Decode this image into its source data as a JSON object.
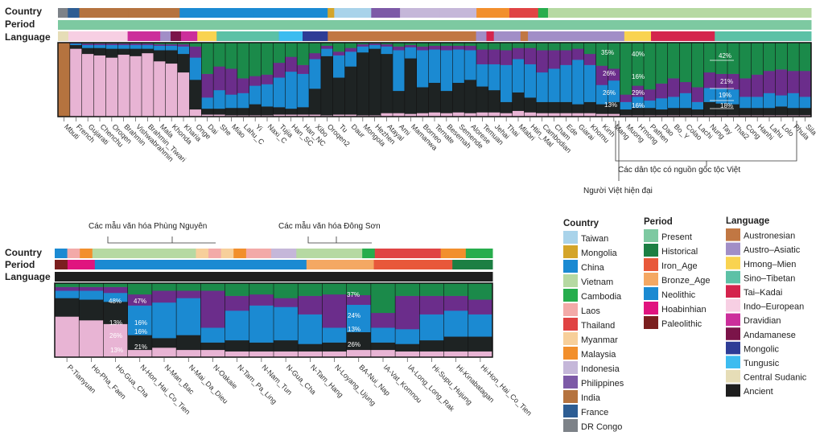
{
  "row_labels": {
    "country": "Country",
    "period": "Period",
    "language": "Language"
  },
  "colors": {
    "country": {
      "Taiwan": "#a9d3ea",
      "Mongolia": "#d4a52a",
      "China": "#1b8ad2",
      "Vietnam": "#b6d9a2",
      "Cambodia": "#27ad4d",
      "Laos": "#f3aaa8",
      "Thailand": "#e04343",
      "Myanmar": "#f7cf9a",
      "Malaysia": "#f28f2c",
      "Indonesia": "#c5b7d9",
      "Philippines": "#7d5aa7",
      "India": "#b5733f",
      "France": "#2d5d93",
      "DR Congo": "#7d8288"
    },
    "period": {
      "Present": "#7dc9a1",
      "Historical": "#1c7f43",
      "Iron_Age": "#e8583a",
      "Bronze_Age": "#f4a863",
      "Neolithic": "#1b8ad2",
      "Hoabinhian": "#e0147f",
      "Paleolithic": "#7b1f1f"
    },
    "language": {
      "Austronesian": "#c17743",
      "Austro-Asiatic": "#a18ec7",
      "Hmong-Mien": "#f9d350",
      "Sino-Tibetan": "#5cc1a6",
      "Tai-Kadai": "#d4244d",
      "Indo-European": "#f7cfe3",
      "Dravidian": "#cc2e9b",
      "Andamanese": "#7b1449",
      "Mongolic": "#2e3c96",
      "Tungusic": "#3dbcf0",
      "Central Sudanic": "#e6ddb7",
      "Ancient": "#1e1e1e"
    }
  },
  "legend": {
    "country_title": "Country",
    "period_title": "Period",
    "language_title": "Language",
    "country": [
      "Taiwan",
      "Mongolia",
      "China",
      "Vietnam",
      "Cambodia",
      "Laos",
      "Thailand",
      "Myanmar",
      "Malaysia",
      "Indonesia",
      "Philippines",
      "India",
      "France",
      "DR Congo"
    ],
    "period": [
      "Present",
      "Historical",
      "Iron_Age",
      "Bronze_Age",
      "Neolithic",
      "Hoabinhian",
      "Paleolithic"
    ],
    "language": [
      "Austronesian",
      "Austro–Asiatic",
      "Hmong–Mien",
      "Sino–Tibetan",
      "Tai–Kadai",
      "Indo–European",
      "Dravidian",
      "Andamanese",
      "Mongolic",
      "Tungusic",
      "Central Sudanic",
      "Ancient"
    ]
  },
  "chart_data": [
    {
      "type": "bar",
      "stacked": true,
      "series": [
        {
          "name": "",
          "color": "#e8b4d4"
        },
        {
          "name": "",
          "color": "#1e2323"
        },
        {
          "name": "",
          "color": "#1b8ad2"
        },
        {
          "name": "",
          "color": "#6b2d8b"
        },
        {
          "name": "",
          "color": "#1b8a4a"
        },
        {
          "name": "",
          "color": "#b5733f"
        }
      ],
      "categories": [
        "Mbuti",
        "French",
        "Gujarati",
        "Chenchu",
        "Oroqen",
        "Brahmin",
        "Vishwabrahmin",
        "Brahmin_Tiwari",
        "Mala",
        "Khonda",
        "Kharia",
        "Onge",
        "Dai",
        "She",
        "Miao",
        "Lahu_C",
        "Yi",
        "Naxi_C",
        "Tujia",
        "Han_SC",
        "Han_NC",
        "Xibo",
        "Oroqen2",
        "Tu",
        "Daur",
        "Mongola",
        "Hezhen",
        "Atayal",
        "Ami",
        "Mamanwa",
        "Borneo",
        "Ternate",
        "Besemah",
        "Semende",
        "Alorese",
        "Temuan",
        "Jehai",
        "Thai",
        "Mlabri",
        "Htin_Mal",
        "Cambodian",
        "Cham",
        "Ede",
        "Giarai",
        "Khomu",
        "Kinh",
        "Mang",
        "Muong",
        "H'mong",
        "Pathen",
        "Dao",
        "Bo_Y",
        "Colao",
        "Lachi",
        "Nung",
        "Tay",
        "Thai2",
        "Cong",
        "Hanhi",
        "Lahu",
        "Lolo",
        "Phula",
        "Sila"
      ],
      "fractions": [
        [
          0,
          0,
          0,
          0,
          0,
          1
        ],
        [
          0.92,
          0.05,
          0.02,
          0.01,
          0,
          0
        ],
        [
          0.85,
          0.08,
          0.04,
          0.02,
          0.01,
          0
        ],
        [
          0.83,
          0.1,
          0.04,
          0.02,
          0.01,
          0
        ],
        [
          0.8,
          0.12,
          0.05,
          0.02,
          0.01,
          0
        ],
        [
          0.84,
          0.08,
          0.05,
          0.02,
          0.01,
          0
        ],
        [
          0.82,
          0.1,
          0.05,
          0.02,
          0.01,
          0
        ],
        [
          0.86,
          0.06,
          0.05,
          0.02,
          0.01,
          0
        ],
        [
          0.75,
          0.15,
          0.06,
          0.02,
          0.02,
          0
        ],
        [
          0.72,
          0.18,
          0.06,
          0.02,
          0.02,
          0
        ],
        [
          0.6,
          0.25,
          0.1,
          0.03,
          0.02,
          0
        ],
        [
          0.1,
          0.4,
          0.3,
          0.15,
          0.05,
          0
        ],
        [
          0.03,
          0.08,
          0.15,
          0.32,
          0.42,
          0
        ],
        [
          0.03,
          0.08,
          0.25,
          0.32,
          0.32,
          0
        ],
        [
          0.02,
          0.1,
          0.18,
          0.35,
          0.35,
          0
        ],
        [
          0.02,
          0.1,
          0.2,
          0.2,
          0.48,
          0
        ],
        [
          0.02,
          0.15,
          0.25,
          0.13,
          0.45,
          0
        ],
        [
          0.02,
          0.12,
          0.3,
          0.13,
          0.43,
          0
        ],
        [
          0.03,
          0.1,
          0.4,
          0.2,
          0.27,
          0
        ],
        [
          0.03,
          0.08,
          0.5,
          0.2,
          0.19,
          0
        ],
        [
          0.03,
          0.1,
          0.45,
          0.12,
          0.3,
          0
        ],
        [
          0.03,
          0.35,
          0.4,
          0.08,
          0.14,
          0
        ],
        [
          0.02,
          0.8,
          0.1,
          0.04,
          0.04,
          0
        ],
        [
          0.03,
          0.5,
          0.3,
          0.05,
          0.12,
          0
        ],
        [
          0.03,
          0.65,
          0.2,
          0.05,
          0.07,
          0
        ],
        [
          0.02,
          0.85,
          0.08,
          0.03,
          0.02,
          0
        ],
        [
          0.02,
          0.9,
          0.05,
          0.02,
          0.01,
          0
        ],
        [
          0.05,
          0.8,
          0.1,
          0.03,
          0.02,
          0
        ],
        [
          0.05,
          0.3,
          0.55,
          0.05,
          0.05,
          0
        ],
        [
          0.04,
          0.75,
          0.15,
          0.03,
          0.03,
          0
        ],
        [
          0.05,
          0.35,
          0.5,
          0.05,
          0.05,
          0
        ],
        [
          0.06,
          0.4,
          0.45,
          0.05,
          0.04,
          0
        ],
        [
          0.05,
          0.3,
          0.55,
          0.06,
          0.04,
          0
        ],
        [
          0.06,
          0.4,
          0.45,
          0.05,
          0.04,
          0
        ],
        [
          0.05,
          0.45,
          0.4,
          0.06,
          0.04,
          0
        ],
        [
          0.06,
          0.35,
          0.3,
          0.2,
          0.09,
          0
        ],
        [
          0.06,
          0.3,
          0.35,
          0.2,
          0.09,
          0
        ],
        [
          0.05,
          0.15,
          0.5,
          0.2,
          0.1,
          0
        ],
        [
          0.08,
          0.25,
          0.45,
          0.15,
          0.07,
          0
        ],
        [
          0.06,
          0.2,
          0.45,
          0.22,
          0.07,
          0
        ],
        [
          0.05,
          0.15,
          0.4,
          0.3,
          0.1,
          0
        ],
        [
          0.05,
          0.15,
          0.45,
          0.25,
          0.1,
          0
        ],
        [
          0.05,
          0.15,
          0.5,
          0.2,
          0.1,
          0
        ],
        [
          0.05,
          0.12,
          0.6,
          0.15,
          0.08,
          0
        ],
        [
          0.05,
          0.15,
          0.5,
          0.15,
          0.15,
          0
        ],
        [
          0.04,
          0.13,
          0.26,
          0.26,
          0.31,
          0
        ],
        [
          0.04,
          0.16,
          0.29,
          0.16,
          0.35,
          0
        ],
        [
          0.02,
          0.08,
          0.1,
          0.1,
          0.7,
          0
        ],
        [
          0.02,
          0.1,
          0.15,
          0.15,
          0.58,
          0
        ],
        [
          0.02,
          0.1,
          0.1,
          0.15,
          0.63,
          0
        ],
        [
          0.02,
          0.08,
          0.15,
          0.2,
          0.55,
          0
        ],
        [
          0.02,
          0.1,
          0.15,
          0.25,
          0.48,
          0
        ],
        [
          0.02,
          0.1,
          0.2,
          0.15,
          0.53,
          0
        ],
        [
          0.02,
          0.08,
          0.1,
          0.2,
          0.6,
          0
        ],
        [
          0.02,
          0.18,
          0.19,
          0.21,
          0.4,
          0
        ],
        [
          0.02,
          0.16,
          0.2,
          0.2,
          0.42,
          0
        ],
        [
          0.02,
          0.15,
          0.2,
          0.21,
          0.42,
          0
        ],
        [
          0.02,
          0.1,
          0.15,
          0.25,
          0.48,
          0
        ],
        [
          0.02,
          0.1,
          0.15,
          0.3,
          0.43,
          0
        ],
        [
          0.02,
          0.1,
          0.2,
          0.3,
          0.38,
          0
        ],
        [
          0.02,
          0.12,
          0.15,
          0.35,
          0.36,
          0
        ],
        [
          0.02,
          0.1,
          0.2,
          0.3,
          0.38,
          0
        ],
        [
          0.02,
          0.1,
          0.15,
          0.35,
          0.38,
          0
        ]
      ],
      "annotations": [
        "35%",
        "26%",
        "26%",
        "13%",
        "40%",
        "16%",
        "29%",
        "16%",
        "42%",
        "21%",
        "19%",
        "18%"
      ]
    },
    {
      "type": "bar",
      "stacked": true,
      "series": [
        {
          "name": "",
          "color": "#e8b4d4"
        },
        {
          "name": "",
          "color": "#1e2323"
        },
        {
          "name": "",
          "color": "#1b8ad2"
        },
        {
          "name": "",
          "color": "#6b2d8b"
        },
        {
          "name": "",
          "color": "#1b8a4a"
        },
        {
          "name": "",
          "color": "#b5733f"
        }
      ],
      "categories": [
        "P-Tianyuan",
        "Ho-Pha_Faen",
        "Ho-Gua_Cha",
        "N-Hon_Hai_Co_Tien",
        "N-Man_Bac",
        "N-Mai_Da_Dieu",
        "N-Oakaie",
        "N-Tam_Pa_Ling",
        "N-Nam_Tun",
        "N-Gua_Cha",
        "N-Tam_Hang",
        "N-Loyang_Ujung",
        "BA-Nui_Nap",
        "IA-Vat_Komnou",
        "IA-Long_Long_Rak",
        "Hi-Supu_Hujung",
        "Hi-Kinabatagan",
        "Hi-Hon_Hai_Co_Tien"
      ],
      "fractions": [
        [
          0.55,
          0.25,
          0.1,
          0.05,
          0.05,
          0
        ],
        [
          0.5,
          0.28,
          0.12,
          0.05,
          0.05,
          0
        ],
        [
          0.45,
          0.3,
          0.12,
          0.08,
          0.05,
          0
        ],
        [
          0.1,
          0.2,
          0.4,
          0.15,
          0.15,
          0
        ],
        [
          0.13,
          0.13,
          0.48,
          0.16,
          0.1,
          0
        ],
        [
          0.1,
          0.2,
          0.5,
          0.1,
          0.1,
          0
        ],
        [
          0.1,
          0.1,
          0.2,
          0.5,
          0.1,
          0
        ],
        [
          0.08,
          0.15,
          0.4,
          0.2,
          0.17,
          0
        ],
        [
          0.08,
          0.12,
          0.5,
          0.15,
          0.15,
          0
        ],
        [
          0.08,
          0.15,
          0.45,
          0.12,
          0.2,
          0
        ],
        [
          0.08,
          0.1,
          0.4,
          0.25,
          0.17,
          0
        ],
        [
          0.08,
          0.12,
          0.2,
          0.45,
          0.15,
          0
        ],
        [
          0.1,
          0.24,
          0.37,
          0.13,
          0.16,
          0
        ],
        [
          0.1,
          0.1,
          0.2,
          0.2,
          0.4,
          0
        ],
        [
          0.08,
          0.1,
          0.2,
          0.45,
          0.17,
          0
        ],
        [
          0.08,
          0.15,
          0.35,
          0.25,
          0.17,
          0
        ],
        [
          0.08,
          0.2,
          0.35,
          0.2,
          0.17,
          0
        ],
        [
          0.08,
          0.2,
          0.3,
          0.2,
          0.22,
          0
        ]
      ],
      "annotations": [
        "48%",
        "47%",
        "13%",
        "16%",
        "26%",
        "16%",
        "13%",
        "21%",
        "37%",
        "24%",
        "13%",
        "26%"
      ]
    }
  ],
  "notes": {
    "viet_groups": "Các dân tộc có nguồn gốc tộc Việt",
    "modern_viet": "Người Việt hiện đại",
    "phung_nguyen": "Các mẫu văn hóa Phùng Nguyên",
    "dong_son": "Các mẫu văn hóa Đông Sơn"
  },
  "panel1_country_bar": [
    "#7d8288",
    "#2d5d93",
    "#b5733f",
    "#b5733f",
    "#1b8ad2",
    "#1b8ad2",
    "#d4a52a",
    "#a9d3ea",
    "#7d5aa7",
    "#c5b7d9",
    "#c5b7d9",
    "#f28f2c",
    "#e04343",
    "#27ad4d",
    "#b6d9a2",
    "#b6d9a2"
  ],
  "panel1_country_w": [
    12,
    14,
    60,
    62,
    90,
    90,
    8,
    45,
    35,
    48,
    45,
    40,
    35,
    12,
    160,
    160
  ],
  "panel1_period_bar": [
    "#7dc9a1"
  ],
  "panel1_language_bar": [
    "#e6ddb7",
    "#f7cfe3",
    "#f7cfe3",
    "#cc2e9b",
    "#a18ec7",
    "#7b1449",
    "#cc2e9b",
    "#f9d350",
    "#5cc1a6",
    "#3dbcf0",
    "#2e3c96",
    "#c17743",
    "#a18ec7",
    "#d4244d",
    "#a18ec7",
    "#c17743",
    "#a18ec7",
    "#f9d350",
    "#d4244d",
    "#5cc1a6"
  ],
  "panel1_language_w": [
    14,
    70,
    10,
    44,
    14,
    14,
    22,
    26,
    84,
    32,
    34,
    200,
    14,
    10,
    36,
    10,
    130,
    36,
    86,
    130
  ],
  "panel2_country_bar": [
    "#1b8ad2",
    "#f3aaa8",
    "#f28f2c",
    "#b6d9a2",
    "#f7cf9a",
    "#f3aaa8",
    "#f7cf9a",
    "#f28f2c",
    "#f3aaa8",
    "#c5b7d9",
    "#b6d9a2",
    "#27ad4d",
    "#e04343",
    "#f28f2c",
    "#27ad4d"
  ],
  "panel2_country_w": [
    16,
    16,
    16,
    132,
    16,
    16,
    16,
    16,
    32,
    32,
    84,
    16,
    84,
    32,
    34
  ],
  "panel2_period_bar": [
    "#7b1f1f",
    "#e0147f",
    "#1b8ad2",
    "#f4a863",
    "#e8583a",
    "#1c7f43"
  ],
  "panel2_period_w": [
    16,
    34,
    264,
    84,
    98,
    50
  ],
  "panel2_language_bar": [
    "#1e1e1e"
  ]
}
